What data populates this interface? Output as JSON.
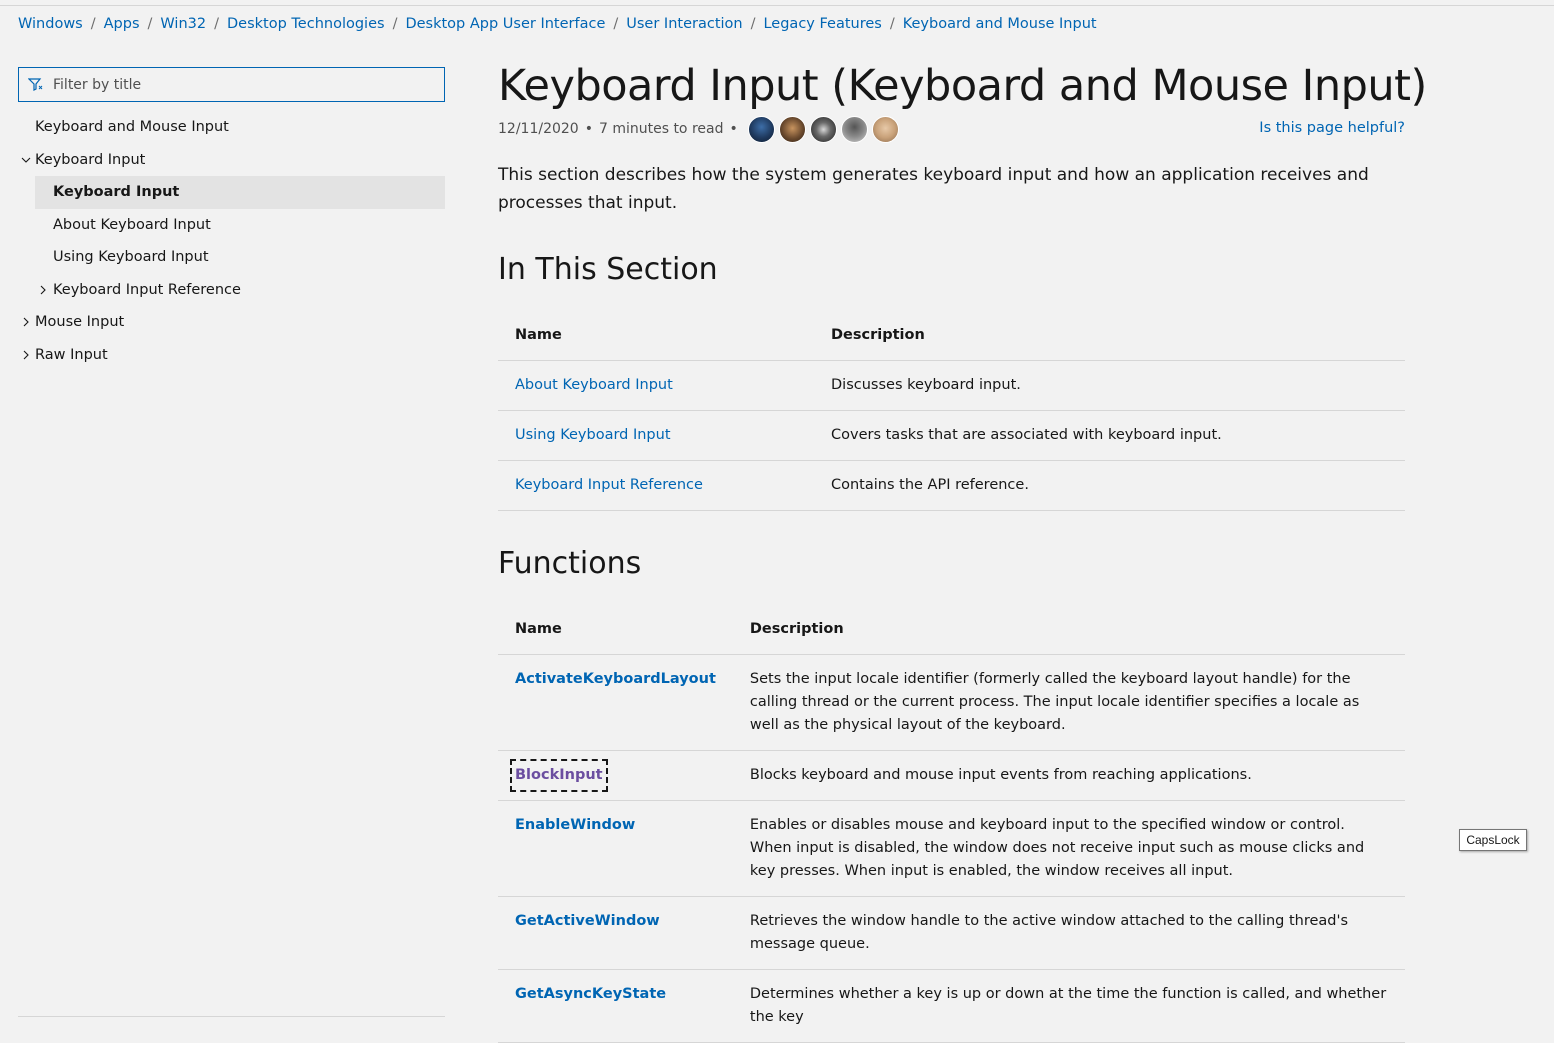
{
  "breadcrumb": [
    "Windows",
    "Apps",
    "Win32",
    "Desktop Technologies",
    "Desktop App User Interface",
    "User Interaction",
    "Legacy Features",
    "Keyboard and Mouse Input"
  ],
  "sidebar": {
    "filter_placeholder": "Filter by title",
    "items": [
      {
        "label": "Keyboard and Mouse Input"
      },
      {
        "label": "Keyboard Input"
      },
      {
        "label": "Keyboard Input"
      },
      {
        "label": "About Keyboard Input"
      },
      {
        "label": "Using Keyboard Input"
      },
      {
        "label": "Keyboard Input Reference"
      },
      {
        "label": "Mouse Input"
      },
      {
        "label": "Raw Input"
      }
    ]
  },
  "article": {
    "title": "Keyboard Input (Keyboard and Mouse Input)",
    "date": "12/11/2020",
    "read_time": "7 minutes to read",
    "helpful": "Is this page helpful?",
    "intro": "This section describes how the system generates keyboard input and how an application receives and processes that input.",
    "section1": {
      "heading": "In This Section",
      "col_name": "Name",
      "col_desc": "Description",
      "rows": [
        {
          "name": "About Keyboard Input",
          "desc": "Discusses keyboard input."
        },
        {
          "name": "Using Keyboard Input",
          "desc": "Covers tasks that are associated with keyboard input."
        },
        {
          "name": "Keyboard Input Reference",
          "desc": "Contains the API reference."
        }
      ]
    },
    "section2": {
      "heading": "Functions",
      "col_name": "Name",
      "col_desc": "Description",
      "rows": [
        {
          "name": "ActivateKeyboardLayout",
          "desc": "Sets the input locale identifier (formerly called the keyboard layout handle) for the calling thread or the current process. The input locale identifier specifies a locale as well as the physical layout of the keyboard."
        },
        {
          "name": "BlockInput",
          "desc": "Blocks keyboard and mouse input events from reaching applications."
        },
        {
          "name": "EnableWindow",
          "desc": "Enables or disables mouse and keyboard input to the specified window or control. When input is disabled, the window does not receive input such as mouse clicks and key presses. When input is enabled, the window receives all input."
        },
        {
          "name": "GetActiveWindow",
          "desc": "Retrieves the window handle to the active window attached to the calling thread's message queue."
        },
        {
          "name": "GetAsyncKeyState",
          "desc": "Determines whether a key is up or down at the time the function is called, and whether the key"
        }
      ]
    }
  },
  "tooltip": {
    "capslock": "CapsLock"
  },
  "colors": {
    "link": "#0065b3",
    "visited": "#6b4ea0",
    "background": "#f2f2f2",
    "selected_bg": "#e3e3e3",
    "divider": "#d6d6d6"
  },
  "avatars": [
    "#1f3a5f",
    "#6b4a2e",
    "#3a3a3a",
    "#8a8a8a",
    "#c9a27a"
  ]
}
